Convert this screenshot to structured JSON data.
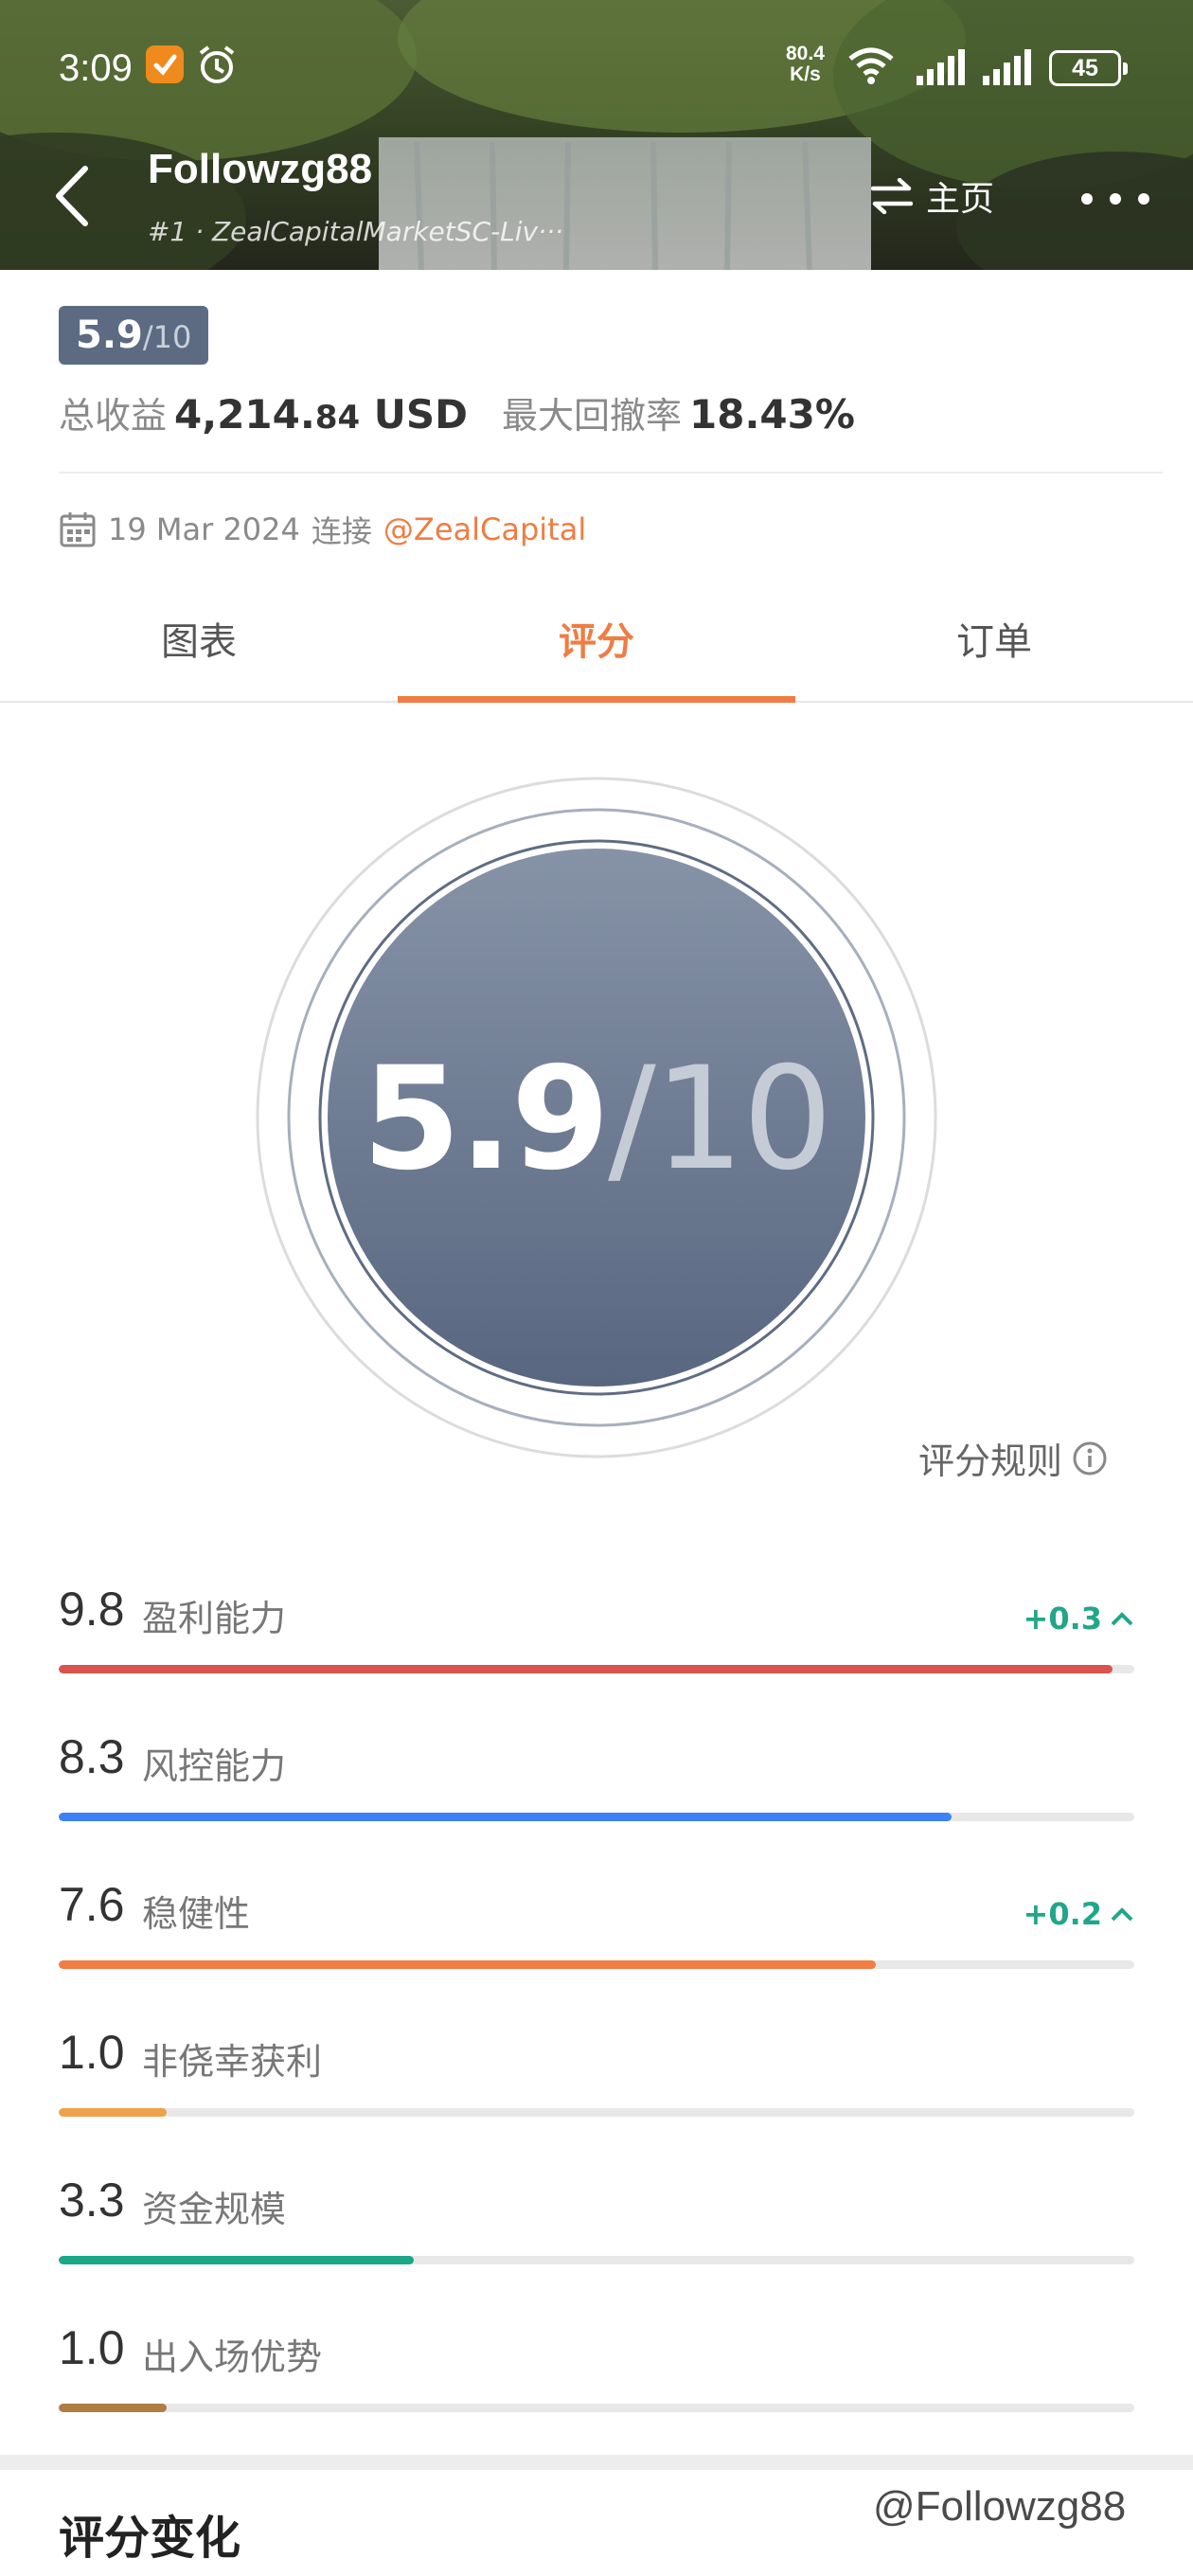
{
  "status_bar": {
    "time": "3:09",
    "net_speed_value": "80.4",
    "net_speed_unit": "K/s",
    "battery": "45"
  },
  "header": {
    "trader_name": "Followzg88",
    "rank_text": "#1 · ZealCapitalMarketSC-Liv···",
    "home_label": "主页"
  },
  "summary": {
    "score": "5.9",
    "score_denominator": "/10",
    "total_profit_label": "总收益",
    "total_profit_value": "4,214.",
    "total_profit_decimals": "84",
    "total_profit_unit": " USD",
    "max_drawdown_label": "最大回撤率",
    "max_drawdown_value": "18.43%",
    "connect_date": "19 Mar 2024",
    "connect_label": "连接",
    "broker_handle": "@ZealCapital"
  },
  "tabs": [
    {
      "label": "图表",
      "active": false
    },
    {
      "label": "评分",
      "active": true
    },
    {
      "label": "订单",
      "active": false
    }
  ],
  "score_panel": {
    "score": "5.9",
    "denominator": "/10",
    "rules_label": "评分规则"
  },
  "metrics": [
    {
      "score": "9.8",
      "label": "盈利能力",
      "delta": "+0.3",
      "fraction": 0.98,
      "color": "#d9534f"
    },
    {
      "score": "8.3",
      "label": "风控能力",
      "delta": "",
      "fraction": 0.83,
      "color": "#3b82f6"
    },
    {
      "score": "7.6",
      "label": "稳健性",
      "delta": "+0.2",
      "fraction": 0.76,
      "color": "#ef7d44"
    },
    {
      "score": "1.0",
      "label": "非侥幸获利",
      "delta": "",
      "fraction": 0.1,
      "color": "#f0a24a"
    },
    {
      "score": "3.3",
      "label": "资金规模",
      "delta": "",
      "fraction": 0.33,
      "color": "#1aa889"
    },
    {
      "score": "1.0",
      "label": "出入场优势",
      "delta": "",
      "fraction": 0.1,
      "color": "#b07d45"
    }
  ],
  "section_title": "评分变化",
  "watermark": "@Followzg88"
}
